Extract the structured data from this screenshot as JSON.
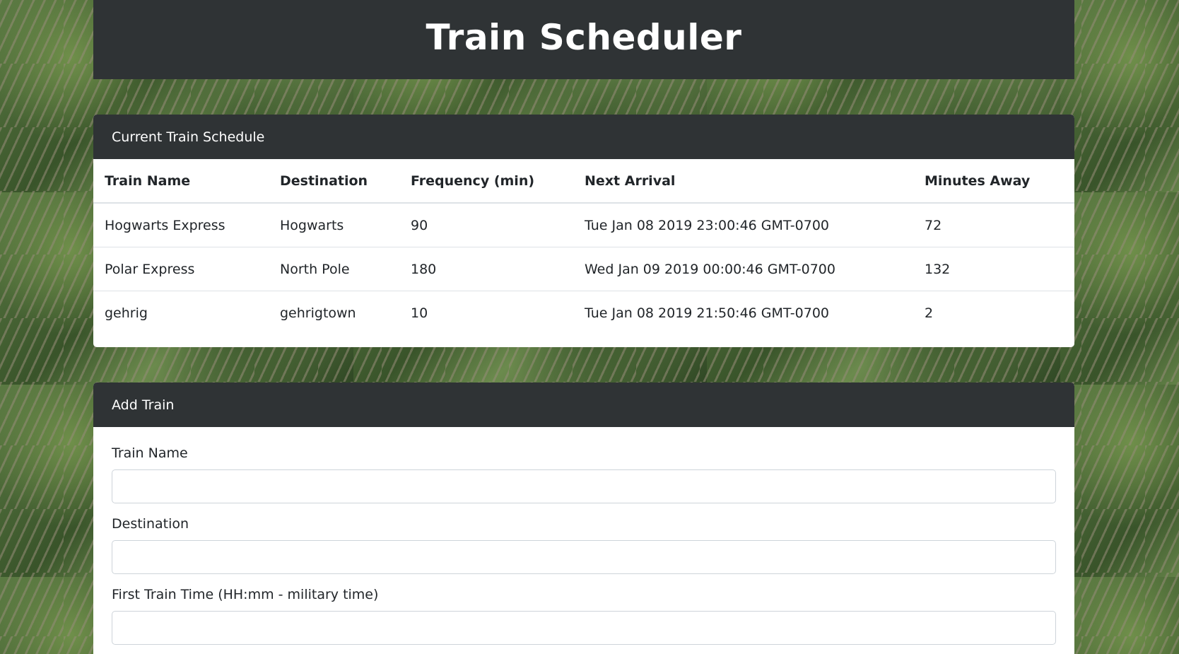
{
  "header": {
    "title": "Train Scheduler"
  },
  "schedule": {
    "card_title": "Current Train Schedule",
    "columns": [
      "Train Name",
      "Destination",
      "Frequency (min)",
      "Next Arrival",
      "Minutes Away"
    ],
    "rows": [
      [
        "Hogwarts Express",
        "Hogwarts",
        "90",
        "Tue Jan 08 2019 23:00:46 GMT-0700",
        "72"
      ],
      [
        "Polar Express",
        "North Pole",
        "180",
        "Wed Jan 09 2019 00:00:46 GMT-0700",
        "132"
      ],
      [
        "gehrig",
        "gehrigtown",
        "10",
        "Tue Jan 08 2019 21:50:46 GMT-0700",
        "2"
      ]
    ]
  },
  "add_train": {
    "card_title": "Add Train",
    "fields": {
      "train_name": {
        "label": "Train Name",
        "value": ""
      },
      "destination": {
        "label": "Destination",
        "value": ""
      },
      "first_train_time": {
        "label": "First Train Time (HH:mm - military time)",
        "value": ""
      }
    }
  },
  "colors": {
    "header_bg": "#2f3335",
    "card_bg": "#ffffff",
    "text": "#212529"
  }
}
